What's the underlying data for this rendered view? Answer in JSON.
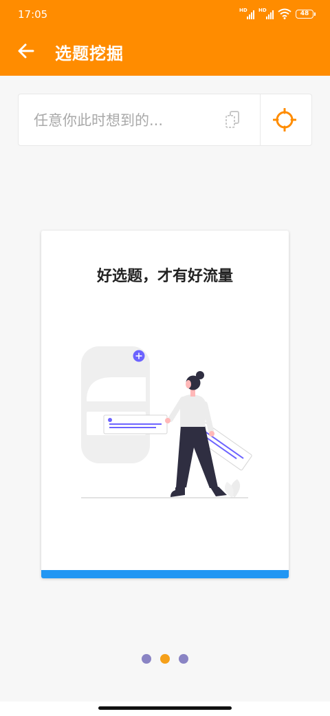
{
  "status_bar": {
    "time": "17:05",
    "signal_1_label": "HD",
    "signal_2_label": "HD",
    "battery": "48"
  },
  "app_bar": {
    "title": "选题挖掘",
    "back_icon": "arrow-left-icon"
  },
  "search": {
    "placeholder": "任意你此时想到的...",
    "paste_icon": "clipboard-icon",
    "locate_icon": "locate-target-icon"
  },
  "carousel": {
    "card_title": "好选题，才有好流量",
    "illustration": "woman-arranging-content-cards-illustration",
    "page_count": 3,
    "active_index": 1
  },
  "colors": {
    "brand": "#ff8c00",
    "card_bar": "#2196f3",
    "dot_inactive": "#8a84c4",
    "dot_active": "#f5a01a",
    "illustration_accent": "#6c63ff"
  }
}
